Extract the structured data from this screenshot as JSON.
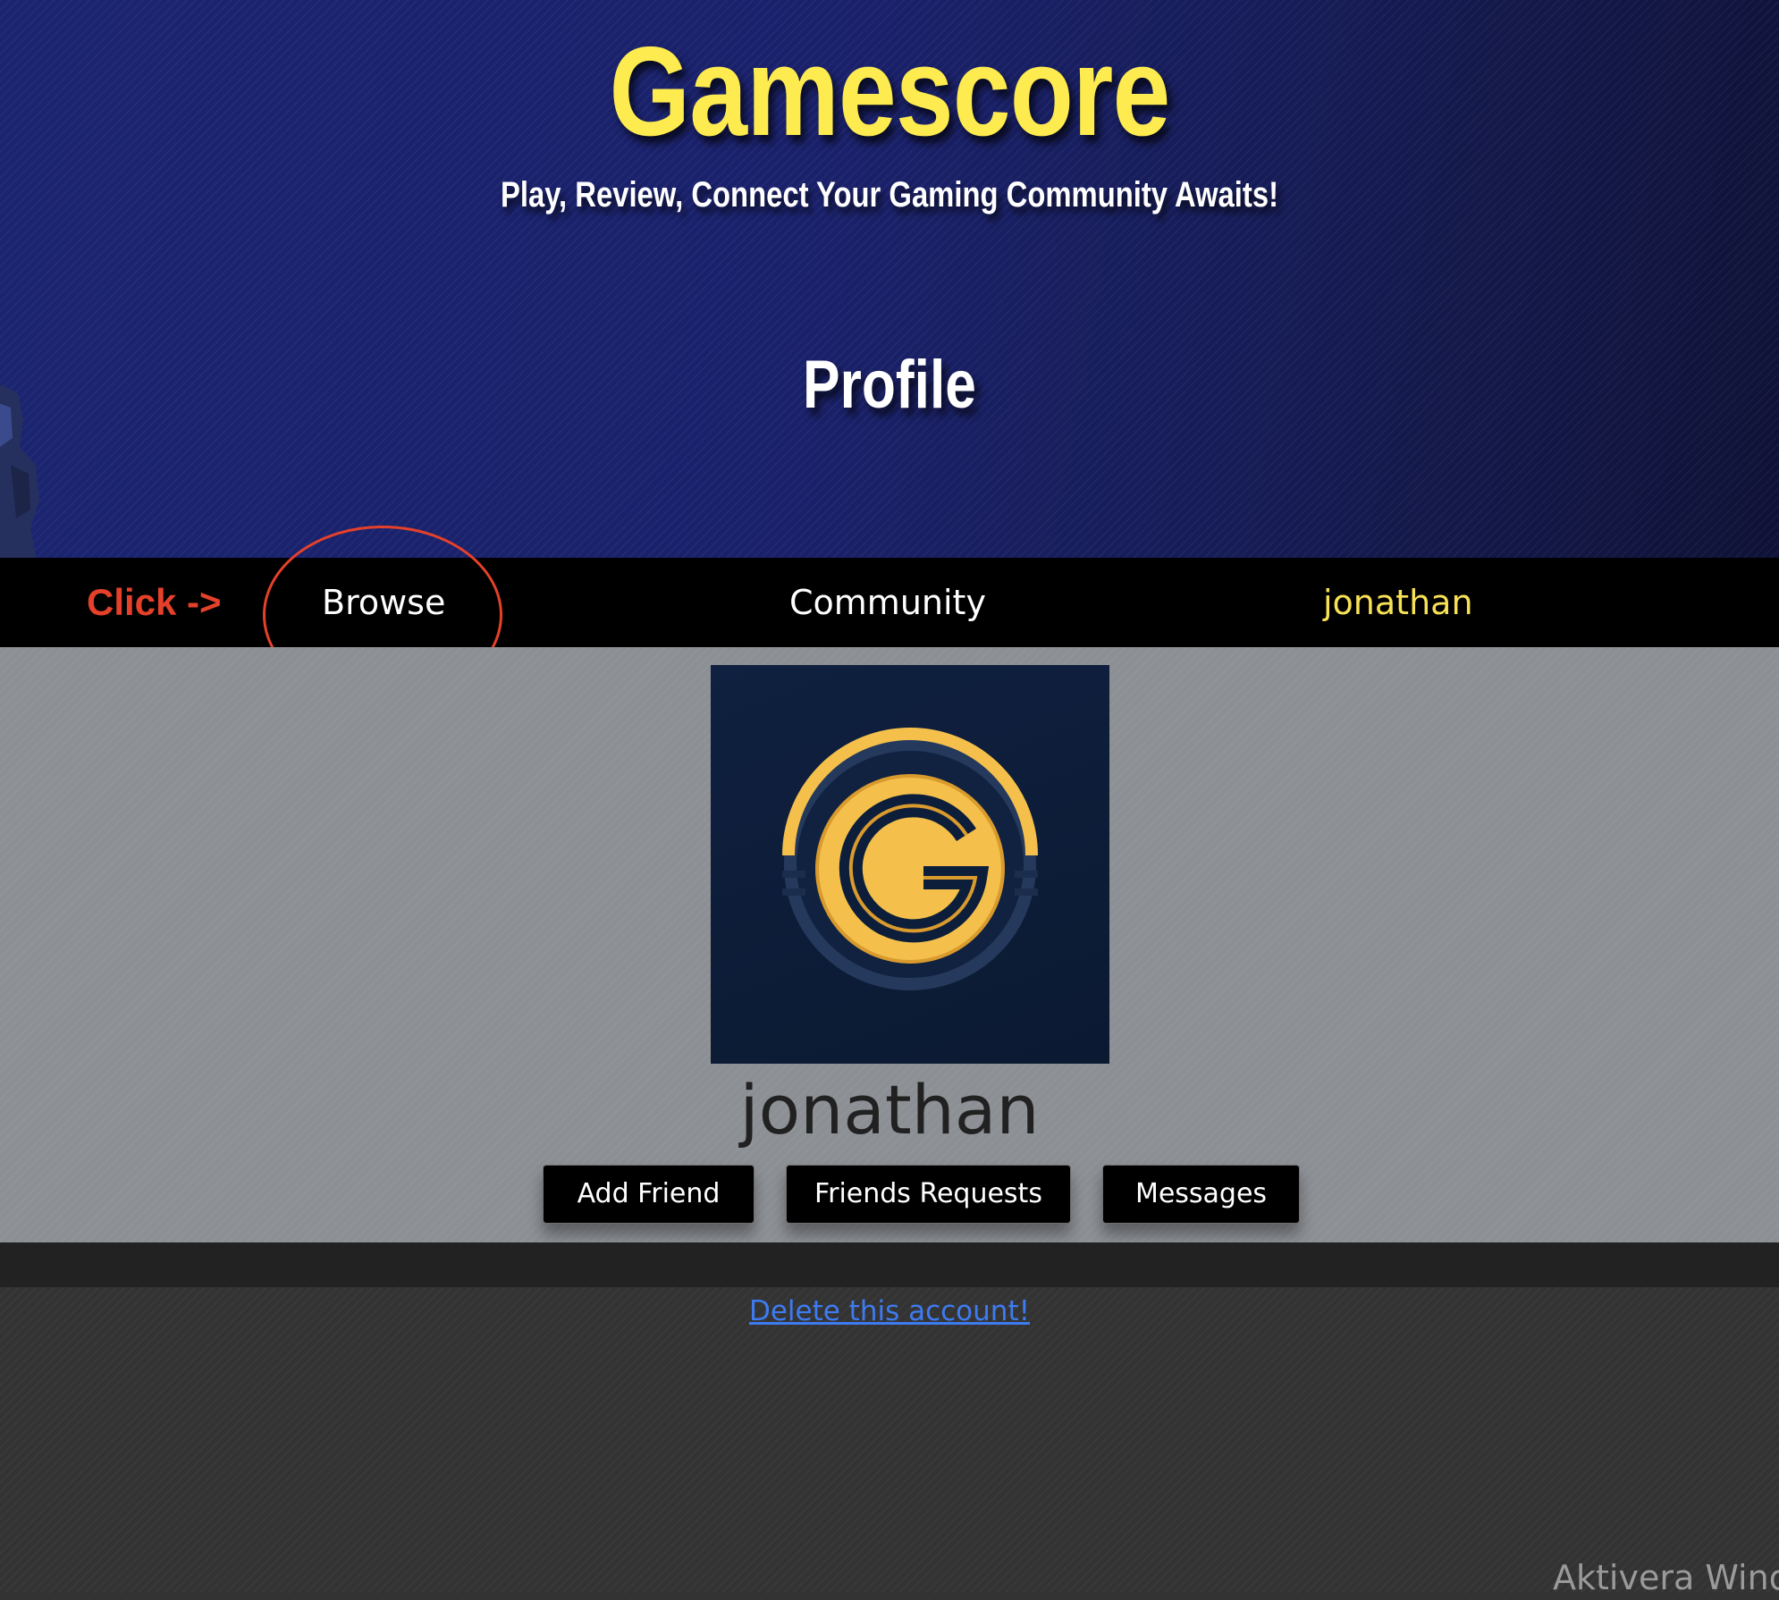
{
  "header": {
    "site_title": "Gamescore",
    "tagline": "Play, Review, Connect Your Gaming Community Awaits!",
    "page_heading": "Profile"
  },
  "nav": {
    "annotation": "Click ->",
    "browse": "Browse",
    "community": "Community",
    "user": "jonathan"
  },
  "profile": {
    "username": "jonathan",
    "avatar_icon": "gamescore-g-logo-icon",
    "buttons": {
      "add_friend": "Add Friend",
      "friends_requests": "Friends Requests",
      "messages": "Messages"
    }
  },
  "footer": {
    "delete_link": "Delete this account!"
  },
  "os_watermark": "Aktivera Windo",
  "colors": {
    "title_yellow": "#fdeb4f",
    "nav_user_yellow": "#f7e155",
    "annotation_red": "#e5412a",
    "link_blue": "#3e7bf0",
    "logo_gold": "#f4c04b",
    "logo_navy": "#0d1e3a"
  }
}
